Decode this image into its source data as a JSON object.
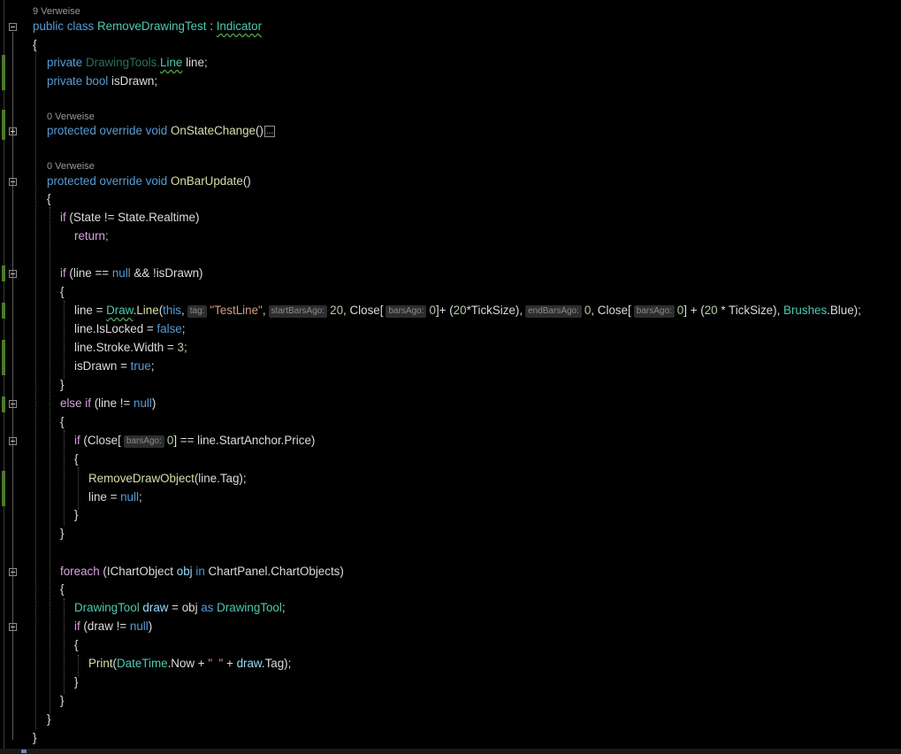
{
  "code_lens": {
    "class_refs": "9 Verweise",
    "statechange_refs": "0 Verweise",
    "barupdate_refs": "0 Verweise"
  },
  "class_decl": {
    "kw1": "public",
    "kw2": "class",
    "name": "RemoveDrawingTest",
    "colon": " : ",
    "base": "Indicator"
  },
  "brace_open": "{",
  "brace_close": "}",
  "fields": {
    "f1": {
      "kw": "private",
      "ns": "DrawingTools.",
      "type": "Line",
      "rest": " line;"
    },
    "f2": {
      "kw": "private",
      "type": "bool",
      "rest": " isDrawn;"
    }
  },
  "method1": {
    "kw": "protected override void",
    "name": "OnStateChange",
    "parens": "()",
    "collapsed": "..."
  },
  "method2": {
    "kw": "protected override void",
    "name": "OnBarUpdate",
    "parens": "()"
  },
  "code": {
    "if1": "if",
    "if1_rest": " (State != State.Realtime)",
    "ret": "return;",
    "if2": "if",
    "if2_a": " (line == ",
    "null": "null",
    "if2_b": " && !isDrawn)",
    "assign_a": "line = ",
    "draw": "Draw",
    "dot": ".",
    "line_fn": "Line",
    "open": "(",
    "this_kw": "this",
    "comma": ",",
    "hint_tag": "tag:",
    "testline": "\"TestLine\"",
    "hint_start": "startBarsAgo:",
    "n20": "20",
    "close_a": ", Close[",
    "hint_bars": "barsAgo:",
    "n0": "0",
    "paren_a": "]+ (",
    "n20b": "20",
    "ticksize_a": "*TickSize),",
    "hint_end": "endBarsAgo:",
    "n0b": "0",
    "close_b": ", Close[",
    "n0c": "0",
    "paren_b": "] + (",
    "n20c": "20",
    "ticksize_b": " * TickSize), ",
    "brushes": "Brushes",
    "blue": ".Blue);",
    "islocked": "line.IsLocked = ",
    "false_kw": "false",
    "semi": ";",
    "stroke": "line.Stroke.Width = ",
    "n3": "3",
    "isdrawn": "isDrawn = ",
    "true_kw": "true",
    "else": "else",
    "elseif": " if",
    "elseif_rest": " (line != ",
    "elseif_close": ")",
    "if3": "if",
    "if3_a": " (Close[",
    "if3_b": "] == line.StartAnchor.Price)",
    "remove": "RemoveDrawObject",
    "remove_rest": "(line.Tag);",
    "line_null": "line = ",
    "foreach": "foreach",
    "fe_a": " (IChartObject ",
    "obj": "obj",
    "in_kw": " in",
    "fe_b": " ChartPanel.ChartObjects)",
    "dtool": "DrawingTool",
    "draw_var": " draw",
    "eq_obj": " = obj ",
    "as_kw": "as",
    "dtool2": " DrawingTool",
    "semi2": ";",
    "if4": "if",
    "if4_a": " (draw != ",
    "if4_b": ")",
    "print": "Print",
    "p_open": "(",
    "datetime": "DateTime",
    "p_now": ".Now + ",
    "p_str": "\"  \"",
    "p_plus": " + ",
    "p_draw": "draw",
    "p_tag": ".Tag);"
  }
}
